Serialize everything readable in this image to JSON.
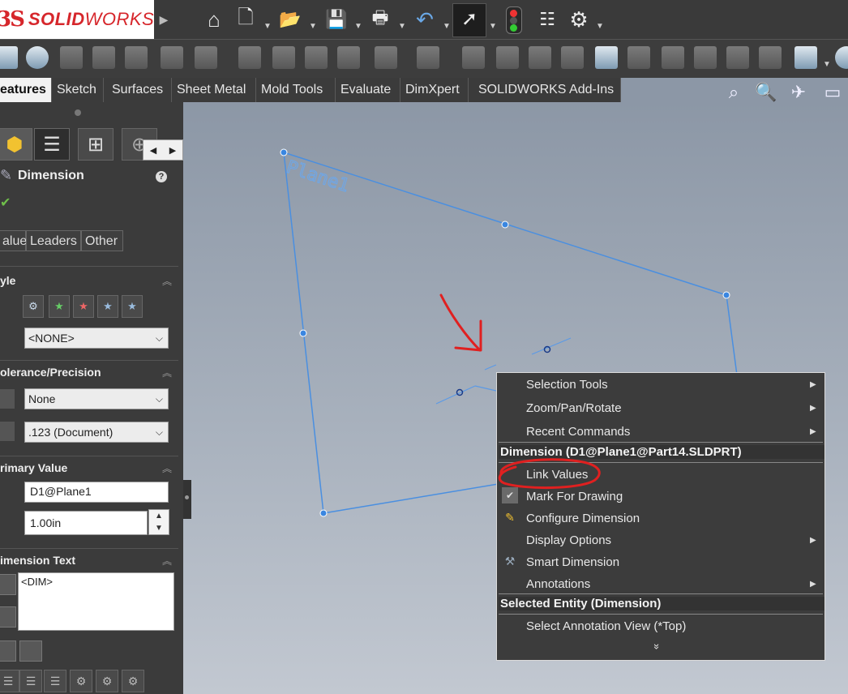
{
  "app": {
    "brand_prefix": "3S",
    "brand_name_bold": "SOLID",
    "brand_name_rest": "WORKS"
  },
  "tabs": [
    "eatures",
    "Sketch",
    "Surfaces",
    "Sheet Metal",
    "Mold Tools",
    "Evaluate",
    "DimXpert",
    "SOLIDWORKS Add-Ins"
  ],
  "property_manager": {
    "title": "Dimension",
    "subtabs": [
      "alue",
      "Leaders",
      "Other"
    ],
    "style": {
      "heading": "yle",
      "dropdown_value": "<NONE>"
    },
    "tolerance": {
      "heading": "olerance/Precision",
      "tolerance_value": "None",
      "precision_value": ".123 (Document)"
    },
    "primary_value": {
      "heading": "rimary Value",
      "name": "D1@Plane1",
      "value": "1.00in"
    },
    "dimension_text": {
      "heading": "imension Text",
      "text": "<DIM>"
    }
  },
  "viewport": {
    "plane_label": "Plane1"
  },
  "context_menu": {
    "items_top": [
      {
        "label": "Selection Tools",
        "submenu": true
      },
      {
        "label": "Zoom/Pan/Rotate",
        "submenu": true
      },
      {
        "label": "Recent Commands",
        "submenu": true
      }
    ],
    "header1": "Dimension (D1@Plane1@Part14.SLDPRT)",
    "items_mid": [
      {
        "label": "Link Values",
        "submenu": false
      },
      {
        "label": "Mark For Drawing",
        "submenu": false,
        "checked": true
      },
      {
        "label": "Configure Dimension",
        "submenu": false
      },
      {
        "label": "Display Options",
        "submenu": true
      },
      {
        "label": "Smart Dimension",
        "submenu": false
      },
      {
        "label": "Annotations",
        "submenu": true
      }
    ],
    "header2": "Selected Entity (Dimension)",
    "items_bottom": [
      {
        "label": "Select Annotation View (*Top)",
        "submenu": false
      }
    ],
    "expand_glyph": "»"
  },
  "colors": {
    "accent_red": "#d6262b",
    "sketch_blue": "#4a8fe0",
    "annotation_red": "#e02020"
  }
}
